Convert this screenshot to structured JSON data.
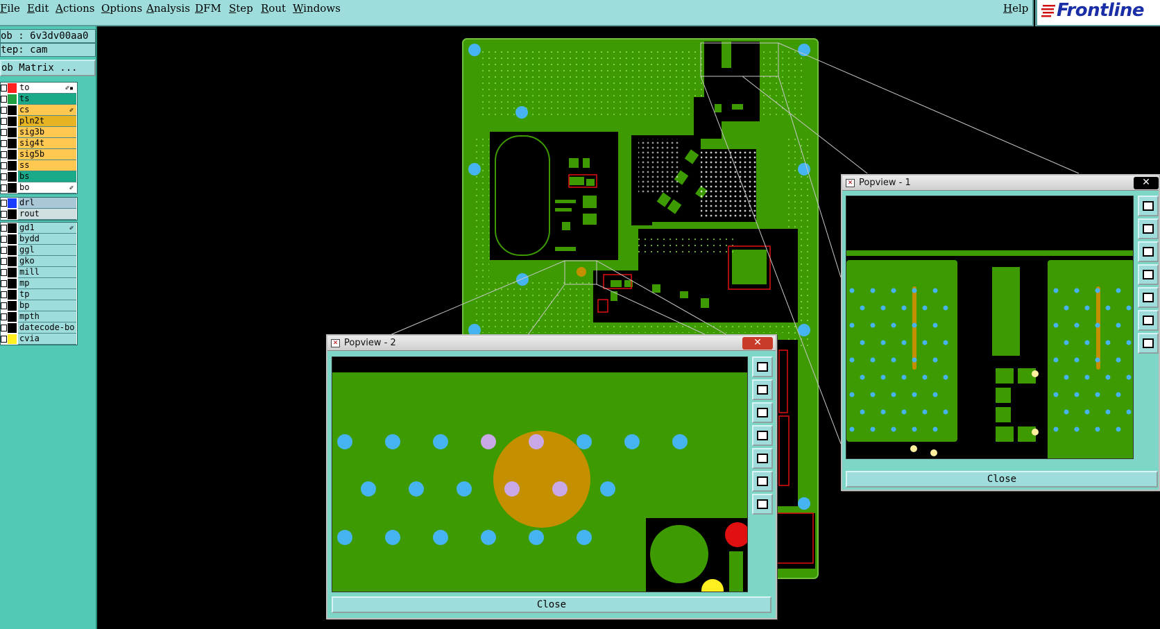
{
  "menu": {
    "items": [
      "File",
      "Edit",
      "Actions",
      "Options",
      "Analysis",
      "DFM",
      "Step",
      "Rout",
      "Windows"
    ],
    "help": "Help"
  },
  "brand": {
    "name": "Frontline",
    "color": "#1a2ea8",
    "stripe_color": "#d01010"
  },
  "job": {
    "job_label": "ob  : 6v3dv00aa0",
    "step_label": "tep: cam",
    "matrix_button": "ob Matrix ..."
  },
  "layers": {
    "group1": [
      {
        "name": "to",
        "color": "#ff2020",
        "bg": "#ffffff",
        "mark": "✐▪"
      },
      {
        "name": "ts",
        "color": "#20a040",
        "bg": "#1aaa8a",
        "mark": ""
      },
      {
        "name": "cs",
        "color": "#000000",
        "bg": "#ffc850",
        "mark": "✐"
      },
      {
        "name": "pln2t",
        "color": "#000000",
        "bg": "#e6b422",
        "mark": ""
      },
      {
        "name": "sig3b",
        "color": "#000000",
        "bg": "#ffc850",
        "mark": ""
      },
      {
        "name": "sig4t",
        "color": "#000000",
        "bg": "#ffc850",
        "mark": ""
      },
      {
        "name": "sig5b",
        "color": "#000000",
        "bg": "#ffc850",
        "mark": ""
      },
      {
        "name": "ss",
        "color": "#000000",
        "bg": "#ffc850",
        "mark": ""
      },
      {
        "name": "bs",
        "color": "#000000",
        "bg": "#1aaa8a",
        "mark": ""
      },
      {
        "name": "bo",
        "color": "#000000",
        "bg": "#ffffff",
        "mark": "✐"
      }
    ],
    "group2": [
      {
        "name": "drl",
        "color": "#1a3cff",
        "bg": "#a8c8d8",
        "mark": ""
      },
      {
        "name": "rout",
        "color": "#000000",
        "bg": "#d0e0e0",
        "mark": ""
      }
    ],
    "group3": [
      {
        "name": "gd1",
        "color": "#000000",
        "bg": "#9fdcdc",
        "mark": "✐"
      },
      {
        "name": "bydd",
        "color": "#000000",
        "bg": "#9fdcdc",
        "mark": ""
      },
      {
        "name": "ggl",
        "color": "#000000",
        "bg": "#9fdcdc",
        "mark": ""
      },
      {
        "name": "gko",
        "color": "#000000",
        "bg": "#9fdcdc",
        "mark": ""
      },
      {
        "name": "mill",
        "color": "#000000",
        "bg": "#9fdcdc",
        "mark": ""
      },
      {
        "name": "mp",
        "color": "#000000",
        "bg": "#9fdcdc",
        "mark": ""
      },
      {
        "name": "tp",
        "color": "#000000",
        "bg": "#9fdcdc",
        "mark": ""
      },
      {
        "name": "bp",
        "color": "#000000",
        "bg": "#9fdcdc",
        "mark": ""
      },
      {
        "name": "mpth",
        "color": "#000000",
        "bg": "#9fdcdc",
        "mark": ""
      },
      {
        "name": "datecode-bo",
        "color": "#000000",
        "bg": "#9fdcdc",
        "mark": ""
      },
      {
        "name": "cvia",
        "color": "#ffee20",
        "bg": "#9fdcdc",
        "mark": ""
      }
    ]
  },
  "colors": {
    "board": "#3d9a00",
    "copper_dark": "#2b6e00",
    "hole": "#45b4f0",
    "pad_orange": "#c49000",
    "pad_yellow": "#fff0a0",
    "outline": "#e01010",
    "title_close": "#c83a2a"
  },
  "popups": {
    "popup1": {
      "title": "Popview - 1",
      "close_x": "✕",
      "close_label": "Close"
    },
    "popup2": {
      "title": "Popview - 2",
      "close_x": "✕",
      "close_label": "Close"
    }
  },
  "tool_icons": [
    "zoom-fit-icon",
    "pan-up-icon",
    "pan-down-icon",
    "pan-left-icon",
    "pan-right-icon",
    "zoom-in-icon",
    "zoom-out-icon"
  ]
}
